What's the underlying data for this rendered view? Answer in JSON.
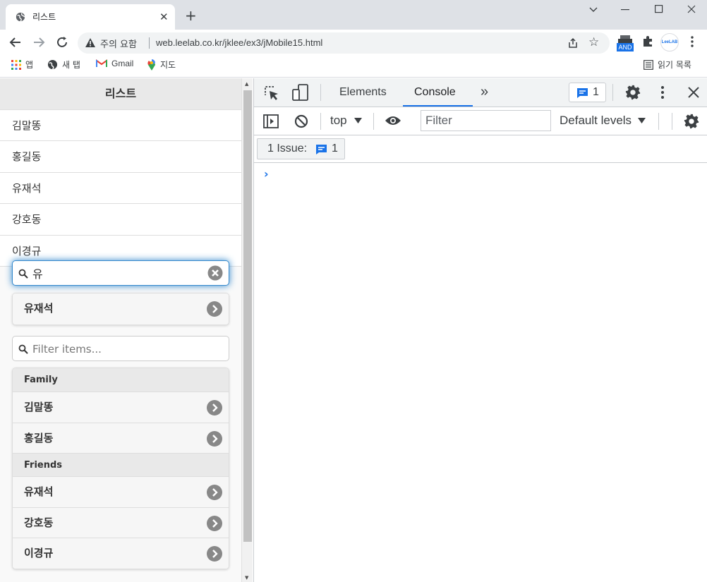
{
  "browser": {
    "tab_title": "리스트",
    "new_tab_icon": "+",
    "close_tab_icon": "✕",
    "window_controls": {
      "minimize": "⌄",
      "restore_min": "—",
      "maximize": "☐",
      "close": "✕"
    },
    "security_label": "주의 요함",
    "url": "web.leelab.co.kr/jklee/ex3/jMobile15.html",
    "extensions": {
      "and_badge": "AND",
      "leelab_badge": "LeeLAB"
    },
    "bookmarks": [
      {
        "label": "앱",
        "icon": "apps-grid-icon"
      },
      {
        "label": "새 탭",
        "icon": "globe-icon"
      },
      {
        "label": "Gmail",
        "icon": "gmail-icon"
      },
      {
        "label": "지도",
        "icon": "maps-pin-icon"
      }
    ],
    "reading_list": "읽기 목록"
  },
  "page": {
    "header_title": "리스트",
    "plain_list": [
      "김말똥",
      "홍길동",
      "유재석",
      "강호동",
      "이경규"
    ],
    "search": {
      "value": "유",
      "placeholder": ""
    },
    "search_results": [
      "유재석"
    ],
    "filter": {
      "value": "",
      "placeholder": "Filter items..."
    },
    "groups": [
      {
        "divider": "Family",
        "items": [
          "김말똥",
          "홍길동"
        ]
      },
      {
        "divider": "Friends",
        "items": [
          "유재석",
          "강호동",
          "이경규"
        ]
      }
    ]
  },
  "devtools": {
    "tabs": [
      "Elements",
      "Console"
    ],
    "active_tab": "Console",
    "more_tabs": "»",
    "issues_count": "1",
    "context": "top",
    "filter_placeholder": "Filter",
    "levels": "Default levels",
    "issue_button_label": "1 Issue:",
    "issue_button_count": "1",
    "prompt_symbol": "›",
    "accent": "#1a73e8"
  }
}
